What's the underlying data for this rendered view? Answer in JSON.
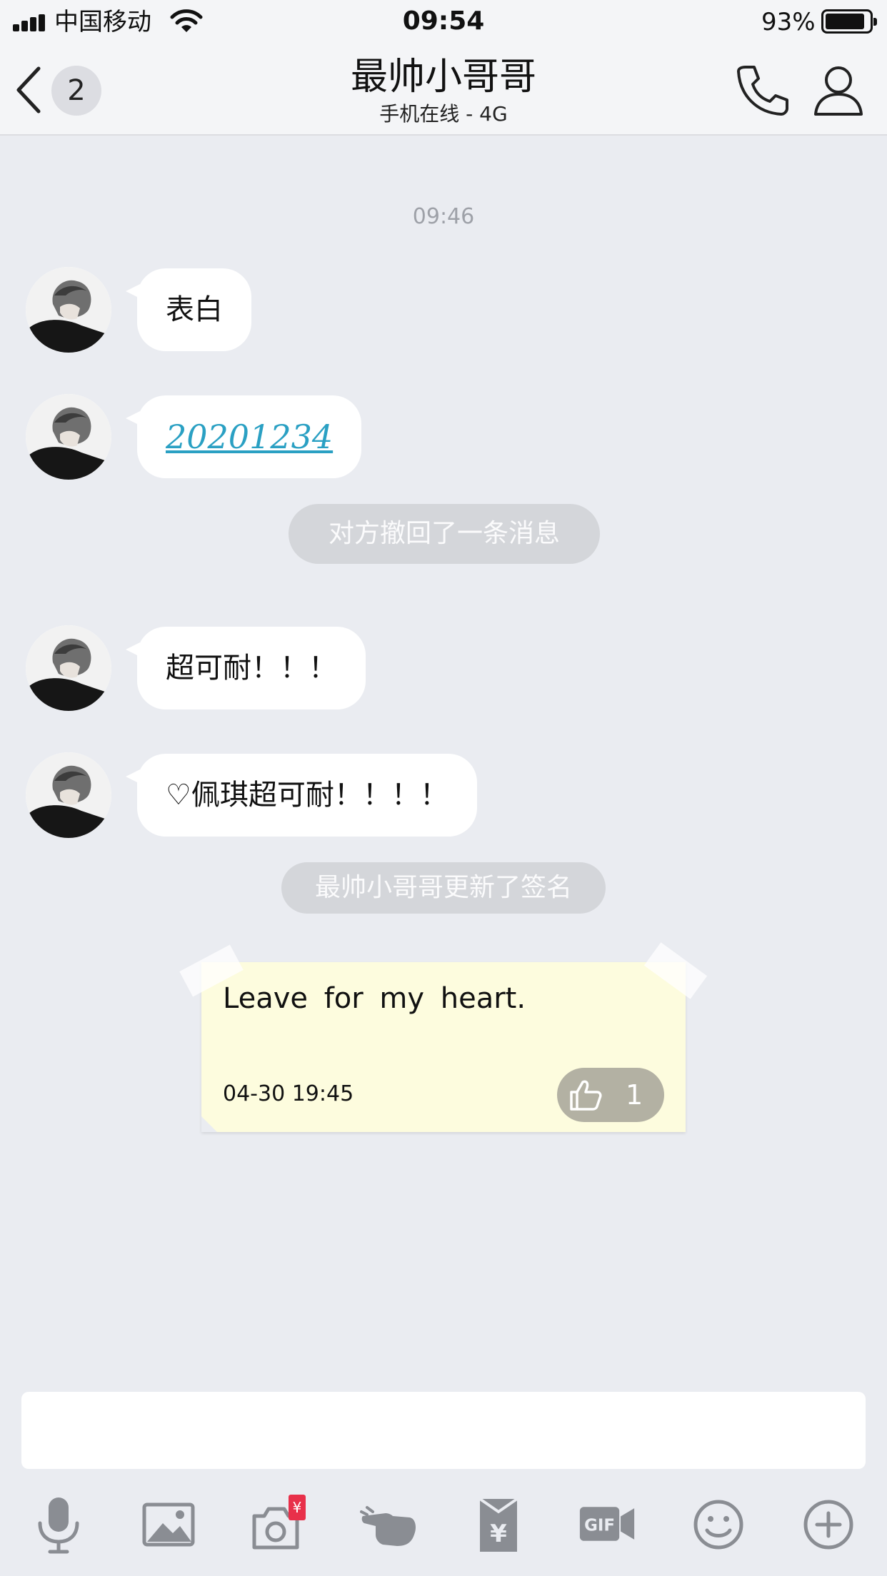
{
  "status_bar": {
    "carrier": "中国移动",
    "time": "09:54",
    "battery_percent": "93%"
  },
  "nav": {
    "unread_count": "2",
    "title": "最帅小哥哥",
    "subtitle": "手机在线 - 4G"
  },
  "chat": {
    "timestamp": "09:46",
    "messages": [
      {
        "text": "表白"
      },
      {
        "text": "20201234"
      },
      {
        "text": "超可耐！！！"
      },
      {
        "text": "♡佩琪超可耐！！！！"
      }
    ],
    "system": {
      "recall": "对方撤回了一条消息",
      "signature_update": "最帅小哥哥更新了签名"
    },
    "signature_note": {
      "text": "Leave for my heart.",
      "date": "04-30 19:45",
      "likes": "1"
    }
  },
  "input": {
    "value": "",
    "placeholder": ""
  },
  "toolbar": {
    "buttons": [
      {
        "icon": "microphone-icon"
      },
      {
        "icon": "image-icon"
      },
      {
        "icon": "camera-icon"
      },
      {
        "icon": "poke-hand-icon"
      },
      {
        "icon": "red-packet-icon"
      },
      {
        "icon": "gif-icon"
      },
      {
        "icon": "emoji-icon"
      },
      {
        "icon": "plus-icon"
      }
    ],
    "red_packet_badge": "¥"
  },
  "colors": {
    "background": "#eaecf1",
    "link": "#2aa0c3",
    "note": "#fdfcde",
    "system_pill": "#d4d6da",
    "icon_gray": "#8a8d93"
  }
}
